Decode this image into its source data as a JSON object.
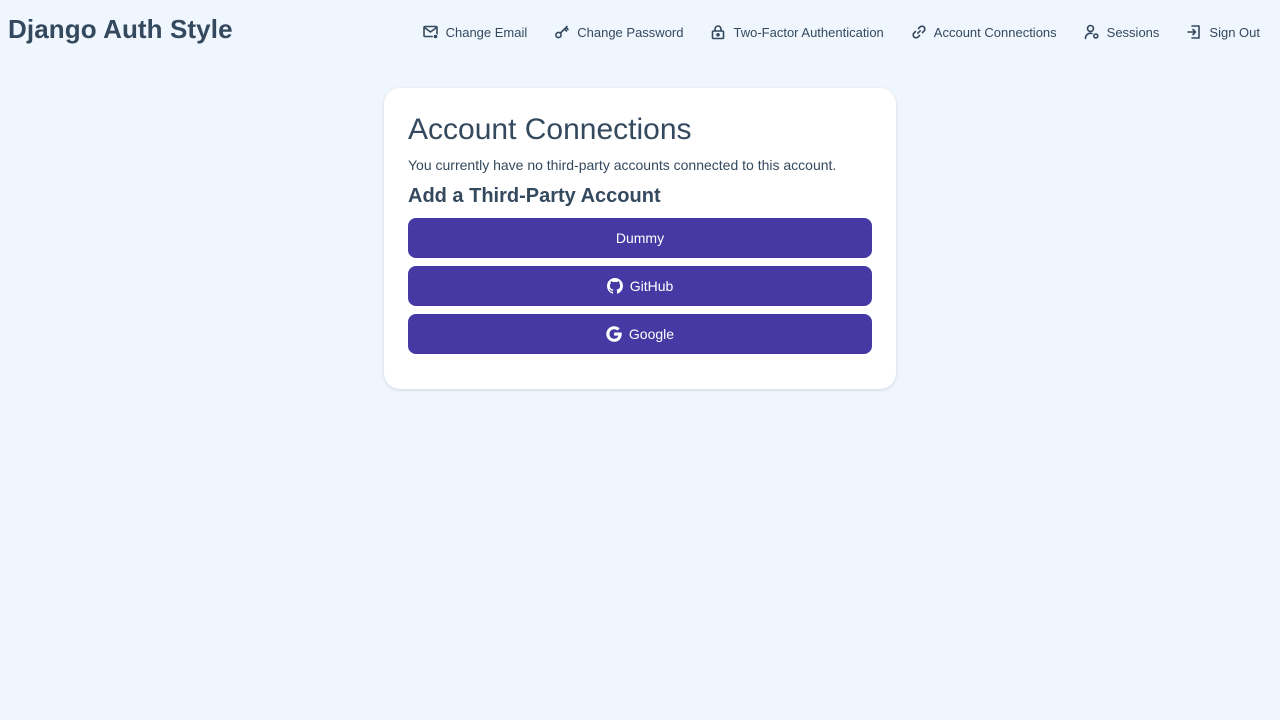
{
  "header": {
    "brand": "Django Auth Style",
    "nav": [
      {
        "label": "Change Email",
        "icon": "mail-icon"
      },
      {
        "label": "Change Password",
        "icon": "key-icon"
      },
      {
        "label": "Two-Factor Authentication",
        "icon": "lock-icon"
      },
      {
        "label": "Account Connections",
        "icon": "link-icon"
      },
      {
        "label": "Sessions",
        "icon": "user-gear-icon"
      },
      {
        "label": "Sign Out",
        "icon": "sign-out-icon"
      }
    ]
  },
  "main": {
    "title": "Account Connections",
    "message": "You currently have no third-party accounts connected to this account.",
    "subtitle": "Add a Third-Party Account",
    "providers": [
      {
        "label": "Dummy",
        "icon": ""
      },
      {
        "label": "GitHub",
        "icon": "github-icon"
      },
      {
        "label": "Google",
        "icon": "google-icon"
      }
    ]
  },
  "colors": {
    "background": "#f0f6fd",
    "text": "#34495e",
    "button": "#4639a3",
    "card": "#ffffff"
  }
}
